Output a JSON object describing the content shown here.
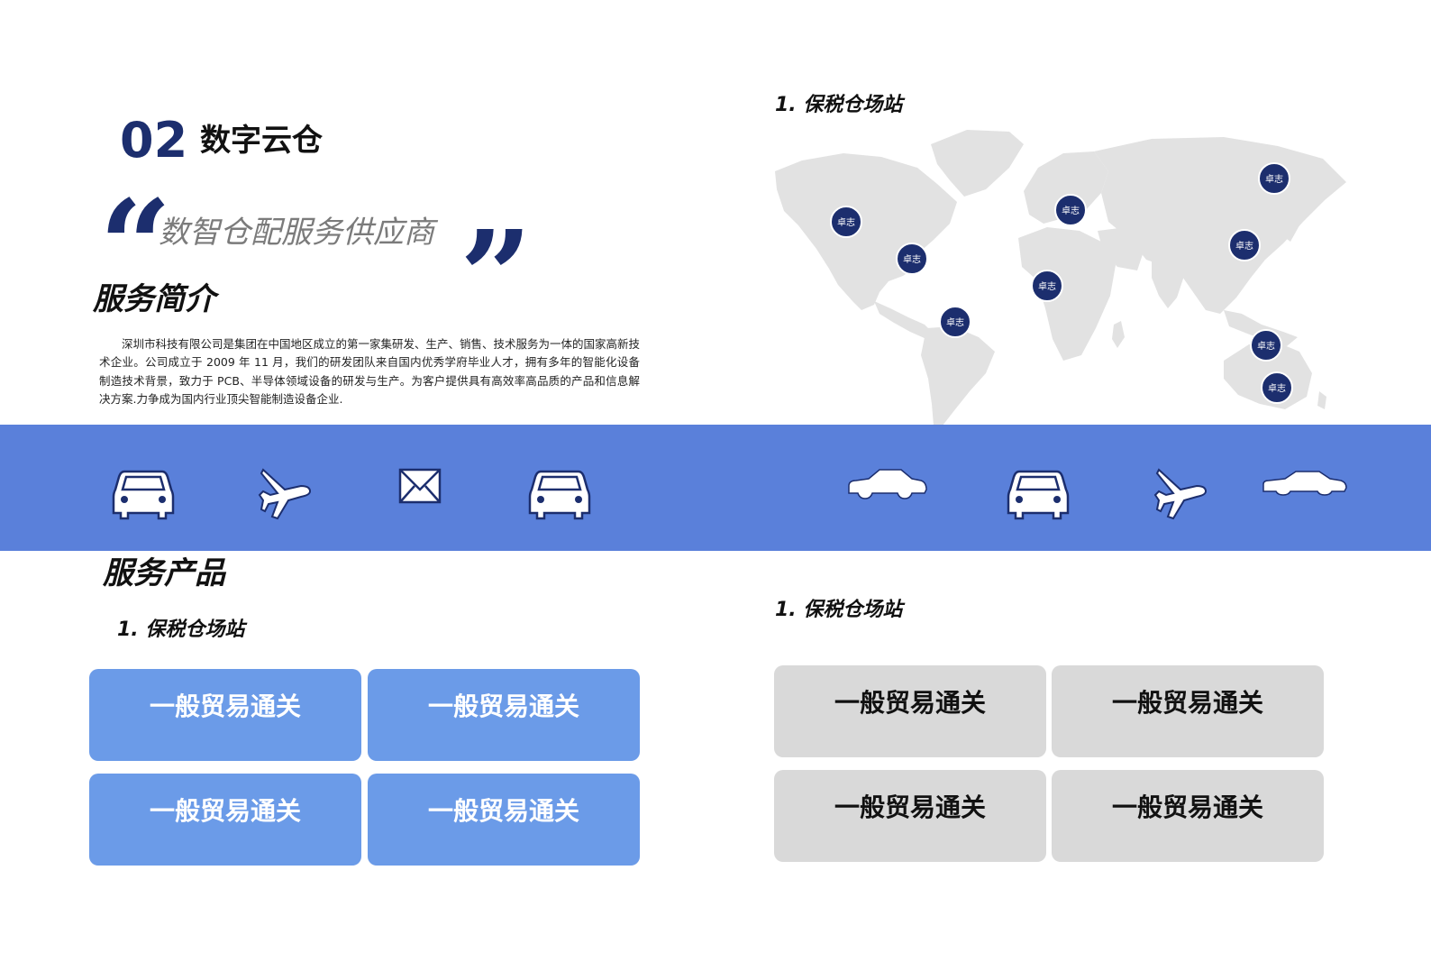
{
  "section": {
    "number": "02",
    "title": "数字云仓"
  },
  "slogan": "数智仓配服务供应商",
  "intro": {
    "title": "服务简介",
    "body": "深圳市科技有限公司是集团在中国地区成立的第一家集研发、生产、销售、技术服务为一体的国家高新技术企业。公司成立于 2009 年 11 月，我们的研发团队来自国内优秀学府毕业人才，拥有多年的智能化设备制造技术背景，致力于 PCB、半导体领域设备的研发与生产。为客户提供具有高效率高品质的产品和信息解决方案.力争成为国内行业顶尖智能制造设备企业."
  },
  "map": {
    "label": "1. 保税仓场站",
    "pins": [
      {
        "label": "卓志"
      },
      {
        "label": "卓志"
      },
      {
        "label": "卓志"
      },
      {
        "label": "卓志"
      },
      {
        "label": "卓志"
      },
      {
        "label": "卓志"
      },
      {
        "label": "卓志"
      },
      {
        "label": "卓志"
      },
      {
        "label": "卓志"
      },
      {
        "label": "卓志"
      }
    ]
  },
  "icon_band": {
    "color": "#5a80da",
    "icons": [
      "car-front-icon",
      "airplane-icon",
      "envelope-icon",
      "car-front-icon",
      "sedan-side-icon",
      "car-front-icon",
      "airplane-icon",
      "sedan-side-icon"
    ]
  },
  "products": {
    "title": "服务产品",
    "left": {
      "label": "1. 保税仓场站",
      "color": "#6b9be8",
      "buttons": [
        "一般贸易通关",
        "一般贸易通关",
        "一般贸易通关",
        "一般贸易通关"
      ]
    },
    "right": {
      "label": "1. 保税仓场站",
      "color": "#d9d9d9",
      "buttons": [
        "一般贸易通关",
        "一般贸易通关",
        "一般贸易通关",
        "一般贸易通关"
      ]
    }
  },
  "colors": {
    "brand_navy": "#1c2e6e",
    "map_land": "#e2e2e2"
  }
}
